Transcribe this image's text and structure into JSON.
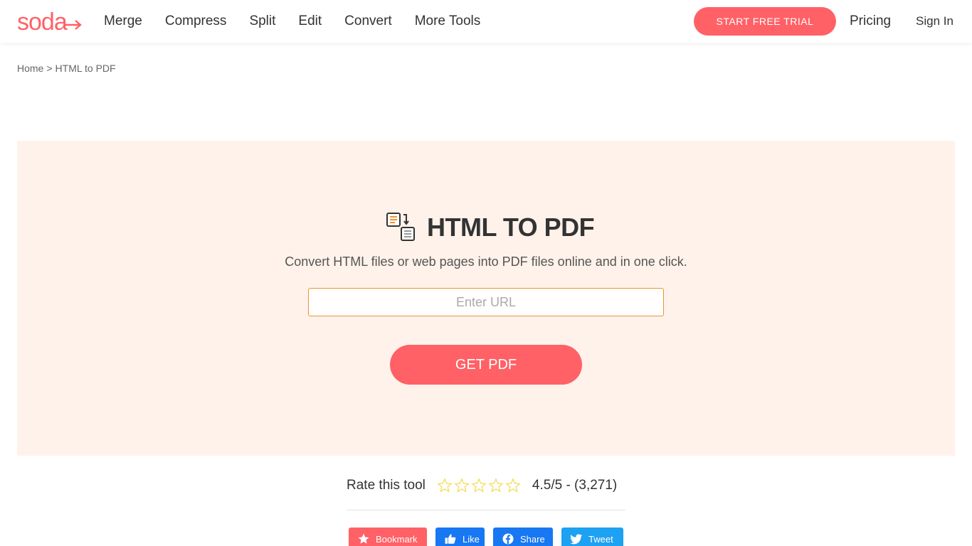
{
  "brand": {
    "name": "soda",
    "color": "#ff6166"
  },
  "nav": {
    "items": [
      "Merge",
      "Compress",
      "Split",
      "Edit",
      "Convert",
      "More Tools"
    ],
    "trial_button": "START FREE TRIAL",
    "pricing": "Pricing",
    "sign_in": "Sign In"
  },
  "breadcrumb": {
    "home": "Home",
    "separator": ">",
    "current": "HTML to PDF"
  },
  "hero": {
    "icon": "html-to-pdf-icon",
    "title": "HTML TO PDF",
    "subtitle": "Convert HTML files or web pages into PDF files online and in one click.",
    "url_input": {
      "value": "",
      "placeholder": "Enter URL"
    },
    "submit_button": "GET PDF",
    "background": "#fff2ea",
    "accent": "#f0922e"
  },
  "rating": {
    "label": "Rate this tool",
    "stars_total": 5,
    "stars_filled": 0,
    "value_text": "4.5/5 - (3,271)"
  },
  "social": {
    "bookmark": "Bookmark",
    "like": "Like",
    "share": "Share",
    "tweet": "Tweet"
  }
}
